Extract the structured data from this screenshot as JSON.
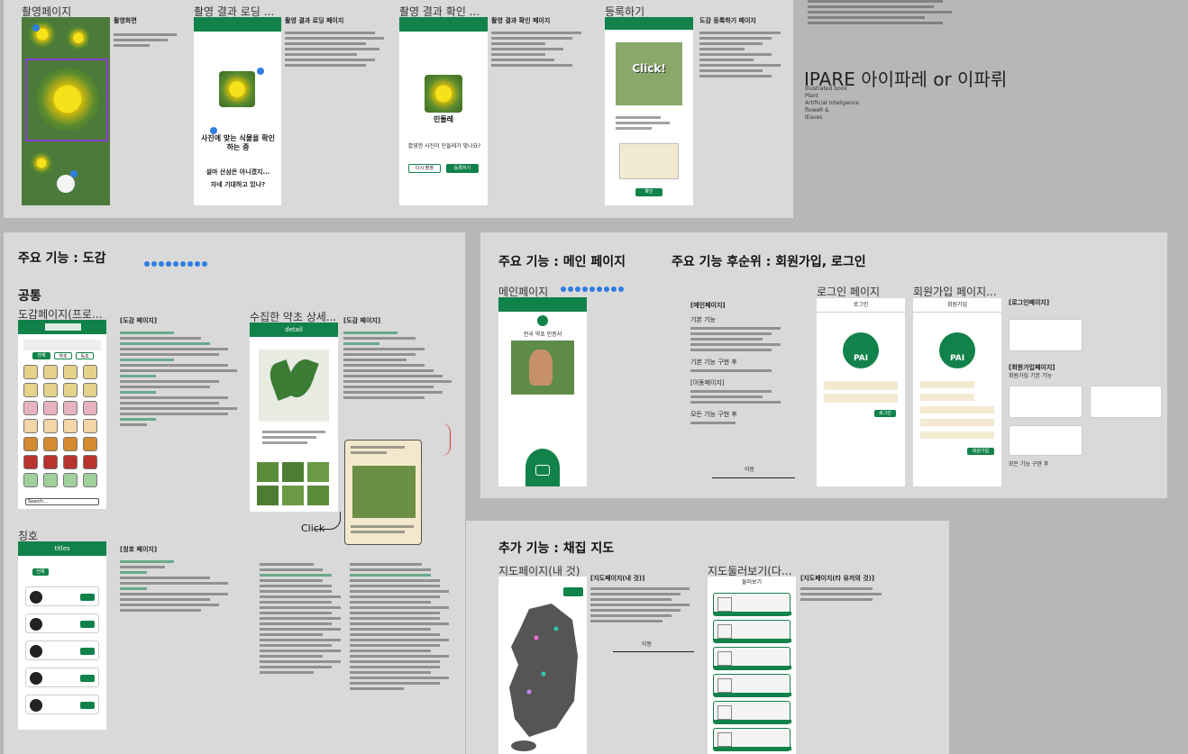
{
  "top": {
    "frames": [
      {
        "title": "촬영페이지"
      },
      {
        "title": "촬영 결과 로딩 ..."
      },
      {
        "title": "촬영 결과 확인 ..."
      },
      {
        "title": "등록하기"
      }
    ],
    "shoot_desc_title": "촬영화면",
    "loading_desc_title": "촬영 결과 로딩 페이지",
    "confirm_desc_title": "촬영 결과 확인 페이지",
    "register_desc_title": "도감 등록하기 페이지",
    "loading_text1": "사진에 맞는 식물을 확인하는 중",
    "loading_text2": "설마 산삼은 아니겠지...",
    "loading_text3": "자네 기대하고 있나?",
    "confirm_name": "민들레",
    "confirm_question": "촬영한 사진이 민들레가 맞나요?",
    "confirm_btn_retry": "다시 촬영",
    "confirm_btn_register": "등록하기",
    "register_click": "Click!",
    "register_btn": "확인",
    "brand_title": "IPARE 아이파레 or 이파뤼",
    "brand_lines": [
      "Illustrated book",
      "Plant",
      "Artificial Inteligence",
      "floweR &",
      "lEaves"
    ]
  },
  "dogam": {
    "heading": "주요 기능 : 도감",
    "common": "공통",
    "frame1_title": "도감페이지(프로...",
    "frame2_title": "수집한 약초 상세...",
    "desc1_title": "[도감 페이지]",
    "desc2_title": "[도감 페이지]",
    "detail_header": "detail",
    "click_label": "Click",
    "title_section": "칭호",
    "title_header": "titles",
    "title_desc": "[칭호 페이지]",
    "search_placeholder": "Search...",
    "tabs": [
      "전체",
      "약초",
      "독초"
    ]
  },
  "main": {
    "heading": "주요 기능 : 메인 페이지",
    "frame_title": "메인페이지",
    "desc_title": "[메인페이지]",
    "sub1": "기본 기능",
    "sub2": "기본 기능 구현 후",
    "sub3": "[이동페이지]",
    "sub4": "모든 기능 구현 후",
    "caption": "전국 약초 인증서",
    "move_label": "이동"
  },
  "auth": {
    "heading": "주요 기능 후순위 : 회원가입, 로그인",
    "login_title": "로그인 페이지",
    "signup_title": "회원가입 페이지...",
    "login_header": "로그인",
    "signup_header": "회원가입",
    "logo_text": "PAI",
    "login_desc": "[로그인페이지]",
    "signup_desc": "[회원가입페이지]",
    "signup_sub": "회원가입 기본 기능",
    "signup_sub2": "모든 기능 구현 후",
    "login_btn": "로그인",
    "signup_btn": "회원가입"
  },
  "map": {
    "heading": "추가 기능 : 채집 지도",
    "frame1_title": "지도페이지(내 것)",
    "frame2_title": "지도둘러보기(다...",
    "desc1": "[지도페이지(내 것)]",
    "desc2": "[지도페이지(타 유저의 것)]",
    "move_label": "이동",
    "list_header": "둘러보기"
  },
  "colors": {
    "accent": "#11824a",
    "marker": "#2f7de1",
    "purple": "#8b3fd6"
  }
}
